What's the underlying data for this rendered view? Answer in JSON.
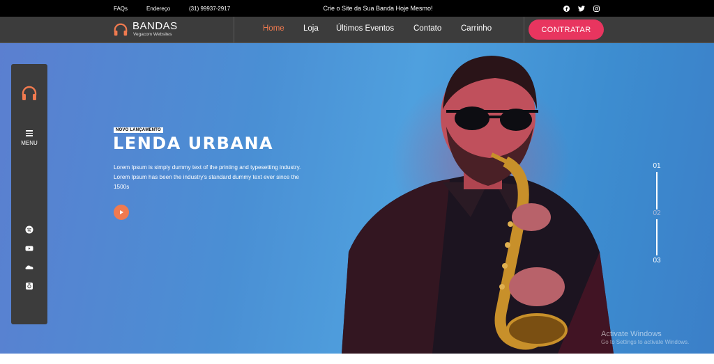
{
  "topbar": {
    "links": [
      "FAQs",
      "Endereço",
      "(31) 99937-2917"
    ],
    "announcement": "Crie o Site da Sua Banda Hoje Mesmo!",
    "social_icons": [
      "facebook-icon",
      "twitter-icon",
      "instagram-icon"
    ]
  },
  "nav": {
    "brand": "BANDAS",
    "brand_sub": "Vegacom Websites",
    "items": [
      {
        "label": "Home",
        "active": true
      },
      {
        "label": "Loja"
      },
      {
        "label": "Últimos Eventos"
      },
      {
        "label": "Contato"
      },
      {
        "label": "Carrinho"
      }
    ],
    "cta": "CONTRATAR"
  },
  "sidebar": {
    "menu_label": "MENU",
    "icons": [
      "spotify-icon",
      "youtube-icon",
      "soundcloud-icon",
      "lastfm-icon"
    ]
  },
  "hero": {
    "badge": "NOVO LANÇAMENTO",
    "title": "LENDA URBANA",
    "text": "Lorem Ipsum is simply dummy text of the printing and typesetting industry. Lorem Ipsum has been the industry's standard dummy text ever since the 1500s"
  },
  "pager": [
    "01",
    "02",
    "03"
  ],
  "watermark": {
    "title": "Activate Windows",
    "subtitle": "Go to Settings to activate Windows."
  },
  "colors": {
    "accent": "#f07a4f",
    "cta": "#e8355f",
    "nav_bg": "#3c3c3c",
    "hero_blue": "#4a8fd4"
  }
}
